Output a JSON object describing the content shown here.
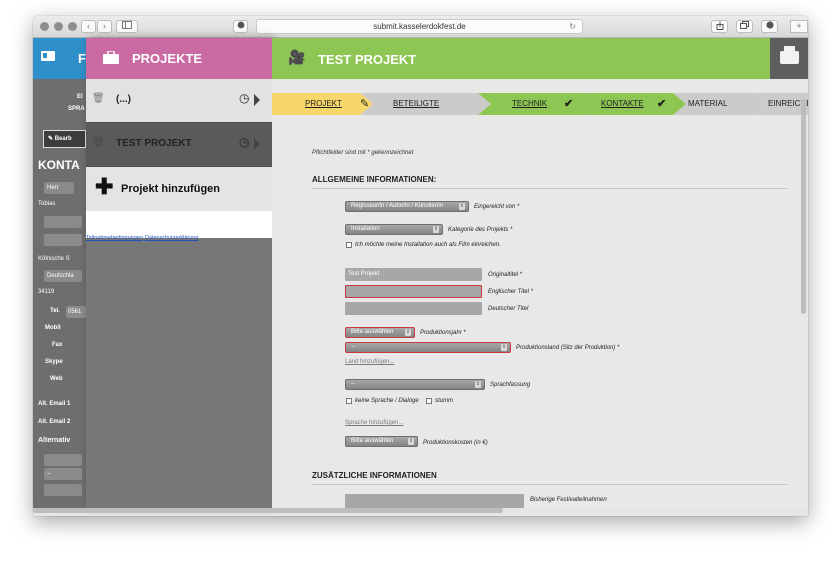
{
  "browser": {
    "url": "submit.kasselerdokfest.de",
    "nav_back": "‹",
    "nav_forward": "›"
  },
  "left_panel": {
    "header_letter": "F",
    "labels": [
      "El",
      "SPRA",
      "Bearb",
      "KONTA",
      "Herr",
      "Tobias",
      "Kölnische S",
      "Deutschla",
      "34119",
      "Tel.",
      "0561",
      "Mobil",
      "Fax",
      "Skype",
      "Web",
      "Alt. Email 1",
      "Alt. Email 2",
      "Alternativ",
      "--"
    ]
  },
  "projects_panel": {
    "title": "PROJEKTE",
    "items": [
      {
        "name": "(...)"
      },
      {
        "name": "TEST PROJEKT"
      }
    ],
    "add_label": "Projekt hinzufügen",
    "links": [
      "Teilnahmebedingungen",
      "Datenschutzerklärung"
    ]
  },
  "main": {
    "title": "TEST PROJEKT",
    "steps": [
      {
        "label": "PROJEKT",
        "state": "active"
      },
      {
        "label": "BETEILIGTE",
        "state": "normal"
      },
      {
        "label": "TECHNIK",
        "state": "done"
      },
      {
        "label": "KONTAKTE",
        "state": "done"
      },
      {
        "label": "MATERIAL",
        "state": "normal"
      },
      {
        "label": "EINREICHEN",
        "state": "normal"
      }
    ],
    "required_note": "Pflichtfelder sind mit * gekennzeichnet",
    "section_general": "ALLGEMEINE INFORMATIONEN:",
    "submitted_by_select": "Regisseur/in / Autor/in / Künstler/in",
    "submitted_by_label": "Eingereicht von *",
    "category_select": "Installation",
    "category_label": "Kategorie des Projekts *",
    "film_checkbox_label": "Ich möchte meine Installation auch als Film einreichen.",
    "original_title_value": "Test Projekt",
    "original_title_label": "Originaltitel *",
    "english_title_label": "Englischer Titel *",
    "german_title_label": "Deutscher Titel",
    "year_select": "Bitte auswählen",
    "year_label": "Produktionsjahr *",
    "country_select": "--",
    "country_label": "Produktionsland (Sitz der Produktion) *",
    "add_country_link": "Land hinzufügen...",
    "language_select": "--",
    "language_label": "Sprachfassung",
    "no_language_label": "keine Sprache / Dialoge",
    "mute_label": "stumm",
    "add_language_link": "Sprache hinzufügen...",
    "costs_select": "Bitte auswählen",
    "costs_label": "Produktionskosten (in €)",
    "section_additional": "ZUSÄTZLICHE INFORMATIONEN",
    "festivals_label": "Bisherige Festivalteilnahmen"
  },
  "colors": {
    "pink": "#c96aa3",
    "green": "#8ec654",
    "yellow": "#f8d76a",
    "blue": "#2f8fc8"
  }
}
